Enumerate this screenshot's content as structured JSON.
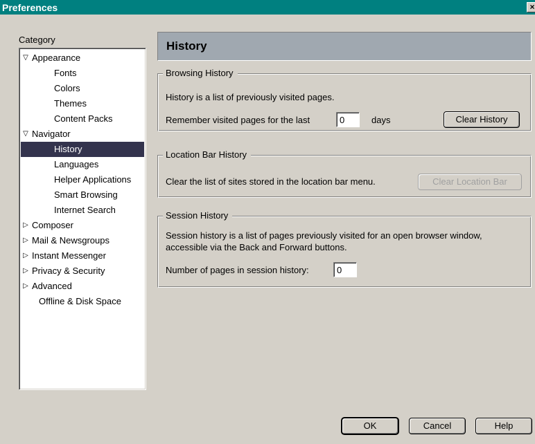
{
  "window": {
    "title": "Preferences",
    "close_glyph": "×"
  },
  "category": {
    "label": "Category",
    "items": [
      {
        "label": "Appearance",
        "level": 0,
        "state": "expanded"
      },
      {
        "label": "Fonts",
        "level": 1
      },
      {
        "label": "Colors",
        "level": 1
      },
      {
        "label": "Themes",
        "level": 1
      },
      {
        "label": "Content Packs",
        "level": 1
      },
      {
        "label": "Navigator",
        "level": 0,
        "state": "expanded"
      },
      {
        "label": "History",
        "level": 1,
        "selected": true
      },
      {
        "label": "Languages",
        "level": 1
      },
      {
        "label": "Helper Applications",
        "level": 1
      },
      {
        "label": "Smart Browsing",
        "level": 1
      },
      {
        "label": "Internet Search",
        "level": 1
      },
      {
        "label": "Composer",
        "level": 0,
        "state": "collapsed"
      },
      {
        "label": "Mail & Newsgroups",
        "level": 0,
        "state": "collapsed"
      },
      {
        "label": "Instant Messenger",
        "level": 0,
        "state": "collapsed"
      },
      {
        "label": "Privacy & Security",
        "level": 0,
        "state": "collapsed"
      },
      {
        "label": "Advanced",
        "level": 0,
        "state": "collapsed"
      },
      {
        "label": "Offline & Disk Space",
        "level": 0,
        "state": "none"
      }
    ]
  },
  "panel": {
    "title": "History",
    "browsing": {
      "title": "Browsing History",
      "description": "History is a list of previously visited pages.",
      "remember_prefix": "Remember visited pages for the last",
      "days_value": "0",
      "days_suffix": "days",
      "clear_button": "Clear History"
    },
    "location": {
      "title": "Location Bar History",
      "description": "Clear the list of sites stored in the location bar menu.",
      "clear_button": "Clear Location Bar"
    },
    "session": {
      "title": "Session History",
      "description_line1": "Session history is a list of pages previously visited for an open browser window,",
      "description_line2": "accessible via the Back and Forward buttons.",
      "pages_label": "Number of pages in session history:",
      "pages_value": "0"
    }
  },
  "footer": {
    "ok": "OK",
    "cancel": "Cancel",
    "help": "Help"
  },
  "colors": {
    "titlebar": "#008080",
    "selection": "#33334d",
    "header_band": "#a0a8b0",
    "face": "#d4d0c8"
  }
}
